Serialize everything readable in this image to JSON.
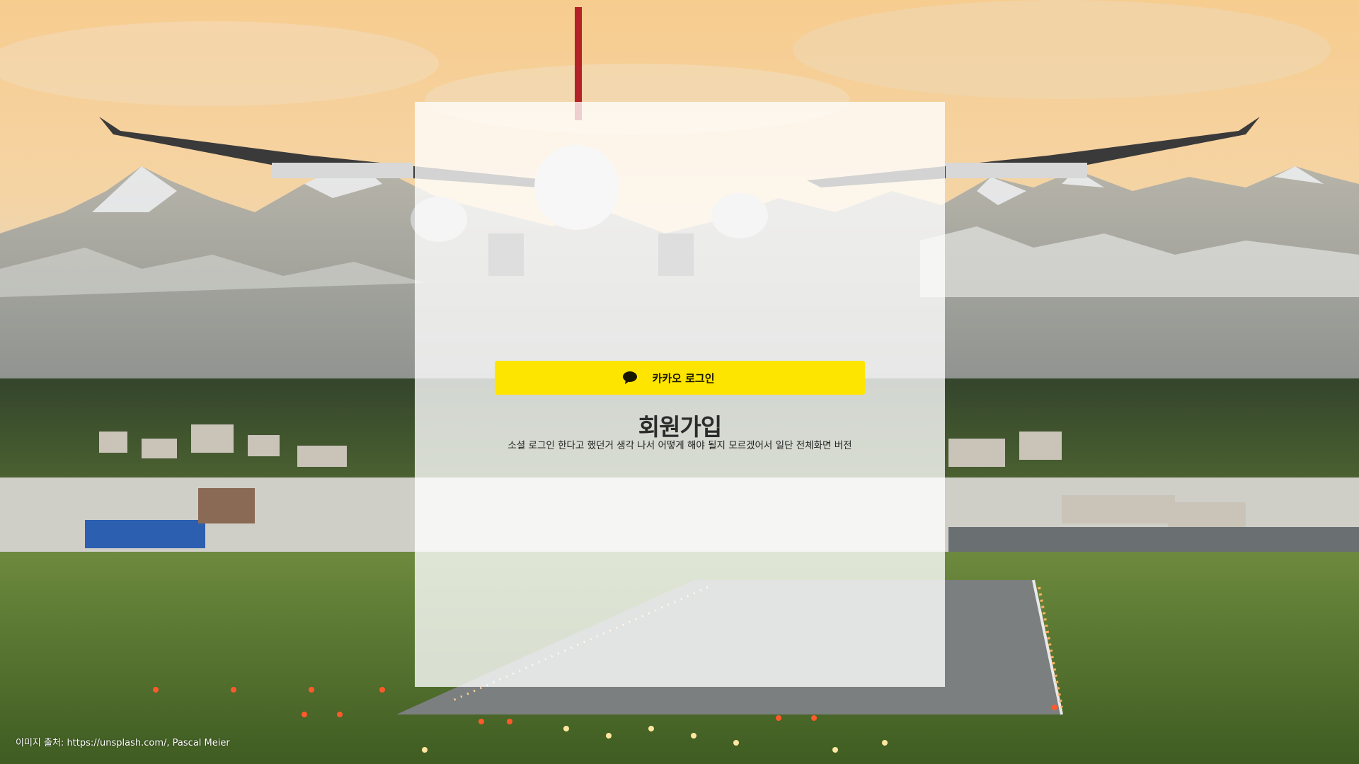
{
  "signup": {
    "title": "회원가입",
    "kakao_button_label": "카카오 로그인",
    "note": "소셜 로그인 한다고 했던거 생각 나서 어떻게 해야 될지 모르겠어서 일단 전체화면 버전"
  },
  "footer": {
    "credit": "이미지 출처: https://unsplash.com/, Pascal Meier"
  },
  "icons": {
    "kakao": "speech-bubble-icon"
  },
  "colors": {
    "kakao_yellow": "#FEE500",
    "card_background": "rgba(255,255,255,0.78)",
    "title_text": "#2b2b2b"
  }
}
